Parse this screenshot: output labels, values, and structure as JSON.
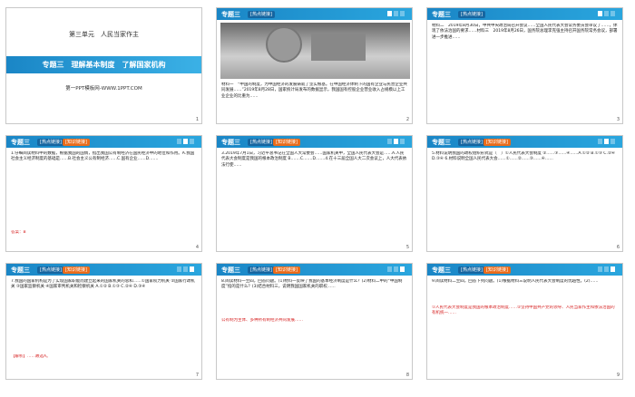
{
  "slides": {
    "s1": {
      "unit": "第三单元　人民当家作主",
      "title": "专题三　理解基本制度　了解国家机构",
      "site": "第一PPT模板网-WWW.1PPT.COM",
      "number": "1"
    },
    "common": {
      "topic": "专题三",
      "tag_a": "[热点链接]",
      "tag_b": "[知识链接]"
    },
    "s2": {
      "text": "材料一　“中国的制度，为中国经济的发展铸就了坚实根基。在中国经济体制下的国有企业与民营企业共同发展……”2019年8月28日，国家统计局发布的数据显示，我国国有控股企业营业收入占规模以上工业企业的比重为……",
      "number": "2"
    },
    "s3": {
      "text": "材料二　2019年8月30日，中共中央政治局召开会议……全国人民代表大会常务委员会审议了……，体现了依法治国的要求……材料三　2019年8月26日，国务院总理李克强主持召开国务院常务会议，部署进一步推进……",
      "number": "3"
    },
    "s4": {
      "text": "1.仔细阅读材料中的数据，根据我国的国情，指出我国公有制经济在国民经济中的地位和作用。A.我国社会主义经济制度的基础是……B.社会主义公有制经济……C.国有企业……D.……",
      "answer": "答案：B",
      "number": "4"
    },
    "s5": {
      "text": "3.2019年7月1日，习近平总书记在全国人大常委会……国家机关中，全国人民代表大会是……A.人民代表大会制度是我国的根本政治制度 B.……C.……D.……4.在十三届全国人大二次会议上，人大代表依法行使……",
      "number": "5"
    },
    "s6": {
      "text": "5.材料说明我国的政权组织形式是（　）①人民代表大会制度 ②……③……④……A.①② B.①③ C.②④ D.③④ 6.材料说明全国人民代表大会……①……②……③……④……",
      "number": "6"
    },
    "s7": {
      "text": "7.我国的国家机构是为了实现国家职能而建立起来的国家机关的总和……①国家权力机关 ②国家行政机关 ③国家监察机关 ④国家审判机关和检察机关 A.①② B.①③ C.②④ D.③④",
      "answer": "【解析】……故选A。",
      "number": "7"
    },
    "s8": {
      "text": "8.阅读材料一至四，回答问题。(1)材料一反映了我国的基本经济制度是什么？(2)材料二中的“中国制度”指的是什么？(3)结合材料三，说明我国国家机关的职权……",
      "answer": "公有制为主体、多种所有制经济共同发展……",
      "number": "8"
    },
    "s9": {
      "text": "9.阅读材料二至四，回答下列问题。(1)根据材料三说明人民代表大会制度的优越性。(2)……",
      "answer": "①人民代表大会制度是我国的根本政治制度……②坚持中国共产党的领导、人民当家作主和依法治国的有机统一……",
      "number": "9"
    }
  }
}
